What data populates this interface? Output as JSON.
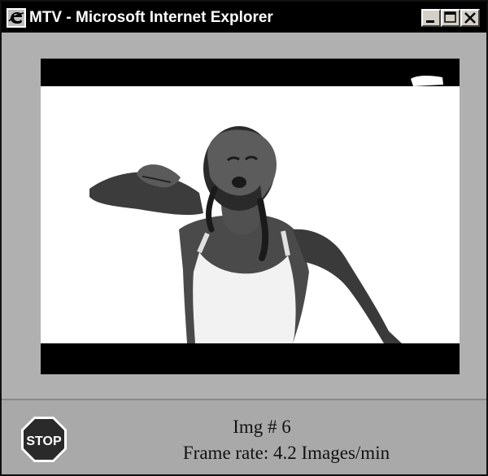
{
  "window": {
    "title": "MTV - Microsoft Internet Explorer",
    "icons": {
      "app": "internet-explorer-icon",
      "minimize": "minimize-icon",
      "maximize": "maximize-icon",
      "close": "close-icon"
    }
  },
  "video": {
    "content": "woman-dancing-in-white-top"
  },
  "status": {
    "stop_label": "STOP",
    "image_number": "Img # 6",
    "frame_rate": "Frame rate: 4.2 Images/min"
  },
  "colors": {
    "titlebar": "#000000",
    "window_bg": "#b4b4b4",
    "stop_sign": "#2a2a2a"
  }
}
